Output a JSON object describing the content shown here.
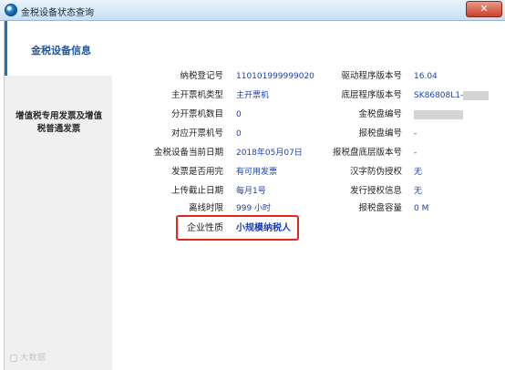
{
  "window": {
    "title": "金税设备状态查询",
    "close_glyph": "✕"
  },
  "sidebar": {
    "active_label": "金税设备信息",
    "item_label_line1": "增值税专用发票及增值",
    "item_label_line2": "税普通发票",
    "watermark": "大数据"
  },
  "info": {
    "left": [
      {
        "label": "纳税登记号",
        "value": "110101999999020"
      },
      {
        "label": "主开票机类型",
        "value": "主开票机"
      },
      {
        "label": "分开票机数目",
        "value": "0"
      },
      {
        "label": "对应开票机号",
        "value": "0"
      },
      {
        "label": "金税设备当前日期",
        "value": "2018年05月07日"
      },
      {
        "label": "发票是否用完",
        "value": "有可用发票"
      },
      {
        "label": "上传截止日期",
        "value": "每月1号"
      },
      {
        "label": "离线时限",
        "value": "999 小时"
      },
      {
        "label": "企业性质",
        "value": "小规模纳税人"
      }
    ],
    "right": [
      {
        "label": "驱动程序版本号",
        "value": "16.04"
      },
      {
        "label": "底层程序版本号",
        "value": "SK86808L1-"
      },
      {
        "label": "金税盘编号",
        "value": ""
      },
      {
        "label": "报税盘编号",
        "value": "-"
      },
      {
        "label": "报税盘底层版本号",
        "value": "-"
      },
      {
        "label": "汉字防伪授权",
        "value": "无"
      },
      {
        "label": "发行授权信息",
        "value": "无"
      },
      {
        "label": "报税盘容量",
        "value": "0 M"
      }
    ]
  },
  "colors": {
    "value_text": "#1b41b5",
    "highlight_border": "#e0261f",
    "active_nav": "#1d5aa5"
  }
}
